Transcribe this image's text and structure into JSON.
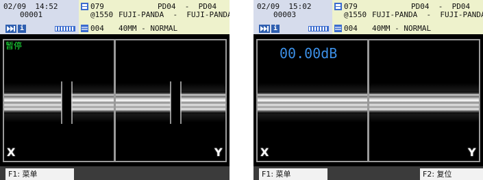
{
  "screens": [
    {
      "date_time": "02/09  14:52",
      "counter": "00001",
      "prog_num": "079",
      "wavelength": "@1550",
      "fiber_code": "004",
      "fiber_type_top": "PD04  -  PD04",
      "fiber_type_mid": "FUJI-PANDA  -  FUJI-PANDA",
      "mode": "40MM - NORMAL",
      "status": "暂停",
      "loss": "",
      "x_label": "X",
      "y_label": "Y",
      "f1": "F1: 菜单",
      "f2": ""
    },
    {
      "date_time": "02/09  15:02",
      "counter": "00003",
      "prog_num": "079",
      "wavelength": "@1550",
      "fiber_code": "004",
      "fiber_type_top": "PD04  -  PD04",
      "fiber_type_mid": "FUJI-PANDA  -  FUJI-PANDA",
      "mode": "40MM - NORMAL",
      "status": "",
      "loss": "00.00dB",
      "x_label": "X",
      "y_label": "Y",
      "f1": "F1: 菜单",
      "f2": "F2: 复位"
    }
  ],
  "colors": {
    "status_green": "#1eea3c",
    "loss_blue": "#3c8fe6",
    "header_left": "#d6dcec",
    "header_right": "#eef2cc"
  },
  "icons": [
    "play-forward-icon",
    "info-icon",
    "waveform-icon",
    "program-icon",
    "fiber-icon"
  ]
}
